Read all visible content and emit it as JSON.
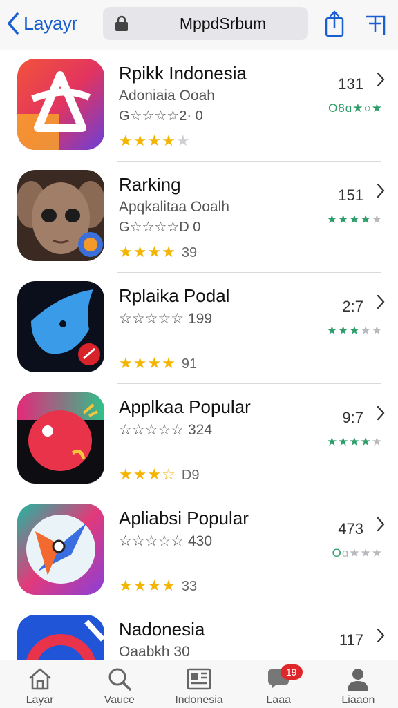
{
  "header": {
    "back_label": "Layayr",
    "url": "MppdSrbum",
    "accent": "#1a5fd0"
  },
  "apps": [
    {
      "title": "Rpikk Indonesia",
      "subtitle": "Adoniaia Ooah",
      "subtitle2": "G☆☆☆☆2· 0",
      "stars_on": "★★★★",
      "stars_off": "★",
      "count": "",
      "rank": "131",
      "right_rating": "O8ɑ★○★",
      "right_on": "",
      "right_off": ""
    },
    {
      "title": "Rarking",
      "subtitle": "Apqkalitaa Ooalh",
      "subtitle2": "G☆☆☆☆D 0",
      "stars_on": "★★★★",
      "stars_off": "",
      "count": "39",
      "rank": "151",
      "right_rating": "",
      "right_on": "★★★★",
      "right_off": "★"
    },
    {
      "title": "Rplaika Podal",
      "subtitle": "☆☆☆☆☆ 199",
      "subtitle2": "",
      "stars_on": "★★★★",
      "stars_off": "",
      "count": "91",
      "rank": "2:7",
      "right_rating": "",
      "right_on": "★★★",
      "right_off": "★★"
    },
    {
      "title": "Applkaa Popular",
      "subtitle": "☆☆☆☆☆ 324",
      "subtitle2": "",
      "stars_on": "★★★",
      "stars_off": "☆",
      "count": "D9",
      "rank": "9:7",
      "right_rating": "",
      "right_on": "★★★★",
      "right_off": "★"
    },
    {
      "title": "Apliabsi Popular",
      "subtitle": "☆☆☆☆☆ 430",
      "subtitle2": "",
      "stars_on": "★★★★",
      "stars_off": "",
      "count": "33",
      "rank": "473",
      "right_rating": "",
      "right_on": "O",
      "right_off": "ɑ★★★"
    },
    {
      "title": "Nadonesia",
      "subtitle": "Oaabkh 30",
      "subtitle2": "",
      "stars_on": "",
      "stars_off": "",
      "count": "",
      "rank": "117",
      "right_rating": "",
      "right_on": "",
      "right_off": ""
    }
  ],
  "tabs": [
    {
      "label": "Layar",
      "icon": "home-icon"
    },
    {
      "label": "Vauce",
      "icon": "search-icon"
    },
    {
      "label": "Indonesia",
      "icon": "news-icon"
    },
    {
      "label": "Laaa",
      "icon": "chat-icon",
      "badge": "19"
    },
    {
      "label": "Liaaon",
      "icon": "person-icon"
    }
  ]
}
